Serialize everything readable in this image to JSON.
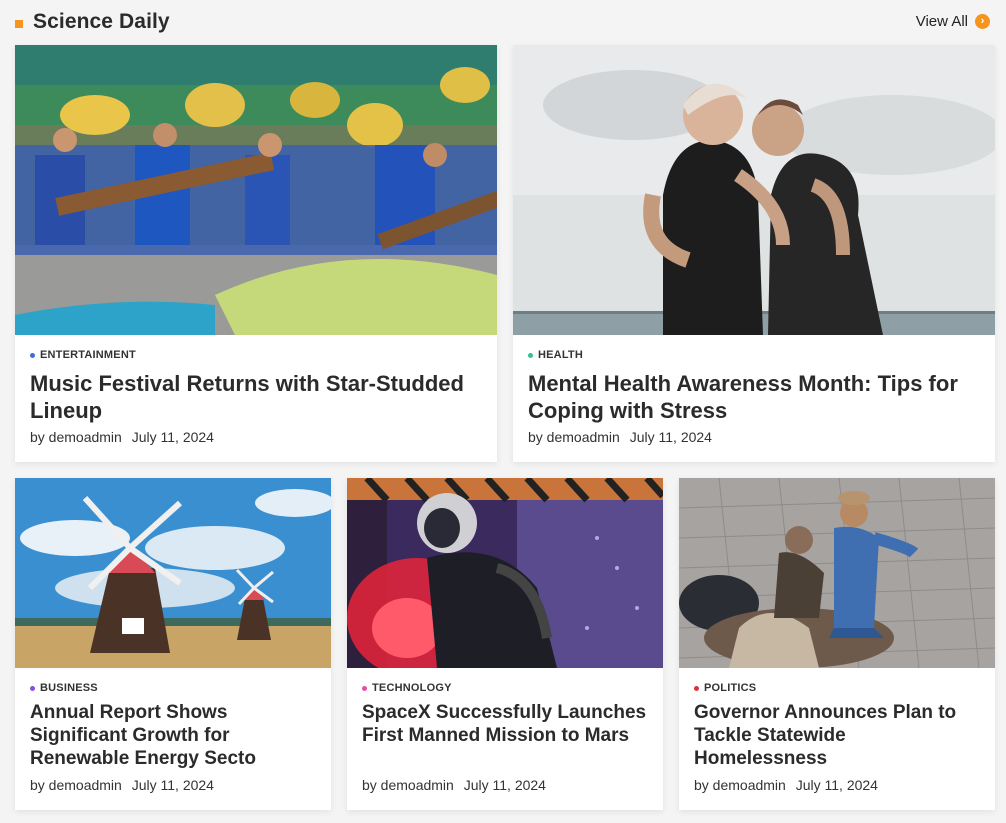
{
  "section": {
    "title": "Science Daily",
    "view_all_label": "View All",
    "view_all_icon": "arrow-right-circle-icon",
    "accent_color": "#f7941d"
  },
  "articles": [
    {
      "category": "ENTERTAINMENT",
      "category_color": "#3b6fd8",
      "title": "Music Festival Returns with Star-Studded Lineup",
      "author": "by demoadmin",
      "date": "July 11, 2024",
      "image": "festival-dancers-photo"
    },
    {
      "category": "HEALTH",
      "category_color": "#2ec58a",
      "title": "Mental Health Awareness Month: Tips for Coping with Stress",
      "author": "by demoadmin",
      "date": "July 11, 2024",
      "image": "two-women-embracing-photo"
    },
    {
      "category": "BUSINESS",
      "category_color": "#8a4de0",
      "title": "Annual Report Shows Significant Growth for Renewable Energy Secto",
      "author": "by demoadmin",
      "date": "July 11, 2024",
      "image": "windmill-photo"
    },
    {
      "category": "TECHNOLOGY",
      "category_color": "#e94aa8",
      "title": "SpaceX Successfully Launches First Manned Mission to Mars",
      "author": "by demoadmin",
      "date": "July 11, 2024",
      "image": "astronaut-red-light-photo"
    },
    {
      "category": "POLITICS",
      "category_color": "#d9343b",
      "title": "Governor Announces Plan to Tackle Statewide Homelessness",
      "author": "by demoadmin",
      "date": "July 11, 2024",
      "image": "man-helping-homeless-photo"
    }
  ]
}
